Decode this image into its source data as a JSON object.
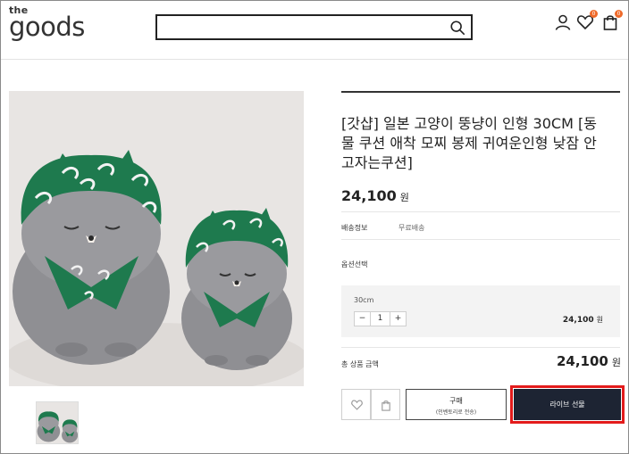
{
  "header": {
    "logo_small": "the",
    "logo_large": "goods",
    "search": {
      "value": "",
      "placeholder": ""
    },
    "wishlist_badge": "0",
    "cart_badge": "0"
  },
  "product": {
    "title": "[갓샵] 일본 고양이 뚱냥이 인형 30CM [동물 쿠션 애착 모찌 봉제 귀여운인형 낮잠 안고자는쿠션]",
    "price": "24,100",
    "currency": "원",
    "shipping_label": "배송정보",
    "shipping_value": "무료배송",
    "option_label": "옵션선택",
    "selected_option": {
      "name": "30cm",
      "minus": "−",
      "quantity": "1",
      "plus": "+",
      "price": "24,100",
      "currency": "원"
    },
    "total_label": "총 상품 금액",
    "total_price": "24,100",
    "total_currency": "원"
  },
  "actions": {
    "buy_label": "구매",
    "buy_sublabel": "(인벤토리로 전송)",
    "live_gift_label": "라이브 선물"
  },
  "colors": {
    "accent_badge": "#ef6a2a",
    "live_button_bg": "#1d2433",
    "highlight_border": "#e31b1b"
  }
}
